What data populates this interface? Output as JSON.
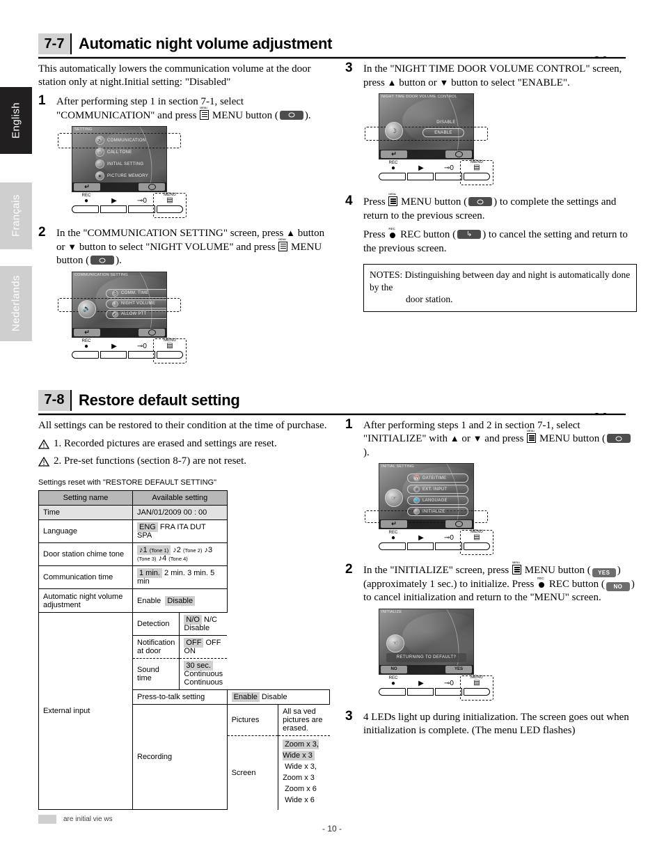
{
  "sidebar": {
    "tabs": [
      {
        "label": "English",
        "active": true
      },
      {
        "label": "Français",
        "active": false
      },
      {
        "label": "Nederlands",
        "active": false
      }
    ]
  },
  "footer": {
    "page_number": "- 10 -"
  },
  "section_77": {
    "number": "7-7",
    "title": "Automatic night volume adjustment",
    "intro": "This automatically lowers the communication volume at the door station only at night.Initial setting: \"Disabled\"",
    "steps": {
      "s1": {
        "num": "1",
        "text_a": "After performing step 1 in section 7-1, select \"COMMUNICATION\"",
        "text_b": "and press",
        "text_c": "MENU button (",
        "text_d": ").",
        "screen": {
          "title": "SETTING",
          "items": [
            {
              "label": "COMMUNICATION",
              "icon": "speaker-icon",
              "selected": true
            },
            {
              "label": "CALL TONE",
              "icon": "bell-icon",
              "selected": false
            },
            {
              "label": "INITIAL SETTING",
              "icon": "hand-icon",
              "selected": false
            },
            {
              "label": "PICTURE MEMORY",
              "icon": "film-icon",
              "selected": false
            }
          ],
          "left_button": "return",
          "right_button": "menu"
        },
        "keys": {
          "rec": "REC",
          "menu": "MENU"
        }
      },
      "s2": {
        "num": "2",
        "text_a": "In the \"COMMUNICATION SETTING\" screen, press",
        "text_b": "button or",
        "text_c": "button to select \"NIGHT VOLUME\" and press",
        "text_d": "MENU button",
        "text_e": "(",
        "text_f": ").",
        "screen": {
          "title": "COMMUNICATION SETTING",
          "items": [
            {
              "label": "COMM. TIME",
              "icon": "clock-icon",
              "selected": false
            },
            {
              "label": "NIGHT VOLUME",
              "icon": "moon-icon",
              "selected": true
            },
            {
              "label": "ALLOW PTT",
              "icon": "mic-icon",
              "selected": false
            }
          ],
          "big_icon": "speaker-icon"
        }
      },
      "s3": {
        "num": "3",
        "text_a": "In the \"NIGHT TIME DOOR VOLUME CONTROL\" screen, press",
        "text_b": "button or",
        "text_c": "button to select \"ENABLE\".",
        "screen": {
          "title": "NIGHT TIME DOOR VOLUME CONTROL",
          "items": [
            {
              "label": "DISABLE",
              "selected": false
            },
            {
              "label": "ENABLE",
              "selected": true
            }
          ],
          "big_icon": "moon-icon"
        }
      },
      "s4": {
        "num": "4",
        "line1_a": "Press",
        "line1_b": "MENU button (",
        "line1_c": ") to complete the settings and return to the previous screen.",
        "line2_a": "Press",
        "line2_b": "REC button (",
        "line2_c": ") to cancel the setting and return to the previous screen."
      }
    },
    "notes": {
      "label": "NOTES:",
      "body_line1": "Distinguishing between day and night is automatically done by the",
      "body_line2": "door station."
    }
  },
  "section_78": {
    "number": "7-8",
    "title": "Restore default setting",
    "intro": "All settings can be restored to their condition at the time of purchase.",
    "warnings": [
      "1.  Recorded pictures are erased and settings are reset.",
      "2.  Pre-set functions (section 8-7) are not reset."
    ],
    "table_caption": "Settings reset with \"RESTORE DEFAULT SETTING\"",
    "legend_swatch_text": "are initial vie     ws",
    "steps": {
      "s1": {
        "num": "1",
        "text_a": "After performing steps 1 and 2 in section 7-1, select \"INITIALIZE\"",
        "text_b": "with",
        "text_c": "or",
        "text_d": "and press",
        "text_e": "MENU button (",
        "text_f": ").",
        "screen": {
          "title": "INITIAL SETTING",
          "items": [
            {
              "label": "DATE/TIME",
              "icon": "calendar-icon",
              "selected": false
            },
            {
              "label": "EXT. INPUT",
              "icon": "plug-icon",
              "selected": false
            },
            {
              "label": "LANGUAGE",
              "icon": "globe-icon",
              "selected": false
            },
            {
              "label": "INITIALIZE",
              "icon": "hand-point-icon",
              "selected": true
            }
          ],
          "big_icon": "hand-icon"
        }
      },
      "s2": {
        "num": "2",
        "text_a": "In the \"INITIALIZE\" screen, press",
        "text_b": "MENU button (",
        "text_c": ")",
        "text_d": "(approximately 1 sec.) to initialize. Press",
        "text_e": "REC button (",
        "text_f": ") to cancel initialization and return to the \"MENU\" screen.",
        "yes_chip": "YES",
        "no_chip": "NO",
        "screen": {
          "title": "INITIALIZE",
          "prompt": "RETURNING TO DEFAULT?",
          "left_button": "NO",
          "right_button": "YES",
          "big_icon": "hand-point-icon"
        }
      },
      "s3": {
        "num": "3",
        "text": "4 LEDs light up during initialization. The screen goes out when initialization is complete. (The menu LED flashes)"
      }
    }
  },
  "settings_table": {
    "headers": [
      "Setting name",
      "Available setting"
    ],
    "rows": [
      {
        "name": "Time",
        "value_plain": "JAN/01/2009 00 : 00",
        "shaded_row": true
      },
      {
        "name": "Language",
        "options": [
          {
            "text": "ENG",
            "highlight": true
          },
          {
            "text": "FRA",
            "highlight": false
          },
          {
            "text": "ITA",
            "highlight": false
          },
          {
            "text": "DUT",
            "highlight": false
          },
          {
            "text": "SPA",
            "highlight": false
          }
        ]
      },
      {
        "name": "Door station chime tone",
        "tones": [
          {
            "num": "1",
            "paren": "(Tone 1)",
            "highlight": true
          },
          {
            "num": "2",
            "paren": "(Tone 2)",
            "highlight": false
          },
          {
            "num": "3",
            "paren": "(Tone 3)",
            "highlight": false
          },
          {
            "num": "4",
            "paren": "(Tone 4)",
            "highlight": false
          }
        ]
      },
      {
        "name": "Communication time",
        "options": [
          {
            "text": "1 min.",
            "highlight": true
          },
          {
            "text": "2 min.",
            "highlight": false
          },
          {
            "text": "3 min.",
            "highlight": false
          },
          {
            "text": "5 min",
            "highlight": false
          }
        ]
      },
      {
        "name": "Automatic night volume adjustment",
        "options": [
          {
            "text": "Enable",
            "highlight": false
          },
          {
            "text": "Disable",
            "highlight": true
          }
        ]
      },
      {
        "group": "External input",
        "sub": "Detection",
        "options": [
          {
            "text": "N/O",
            "highlight": true
          },
          {
            "text": "N/C",
            "highlight": false
          },
          {
            "text": "Disable",
            "highlight": false
          }
        ]
      },
      {
        "group": "External input",
        "sub": "Notification at door",
        "options": [
          {
            "text": "OFF",
            "highlight": true
          },
          {
            "text": "OFF",
            "highlight": false
          },
          {
            "text": "ON",
            "highlight": false
          }
        ]
      },
      {
        "group": "External input",
        "sub": "Sound time",
        "options": [
          {
            "text": "30 sec.",
            "highlight": true
          },
          {
            "text": "Continuous",
            "highlight": false
          },
          {
            "text": "Continuous",
            "highlight": false
          }
        ]
      },
      {
        "name": "Press-to-talk setting",
        "options": [
          {
            "text": "Enable",
            "highlight": true
          },
          {
            "text": "Disable",
            "highlight": false
          }
        ]
      },
      {
        "group": "Recording",
        "sub": "Pictures",
        "value_plain": "All sa     ved pictures are erased."
      },
      {
        "group": "Recording",
        "sub": "Screen",
        "lines": [
          {
            "text": "Zoom x 3, Wide x 3",
            "highlight": true
          },
          {
            "text": "Wide x 3, Zoom x 3",
            "highlight": false
          },
          {
            "text": "Zoom x 6",
            "highlight": false
          },
          {
            "text": "Wide x 6",
            "highlight": false
          }
        ]
      }
    ]
  }
}
